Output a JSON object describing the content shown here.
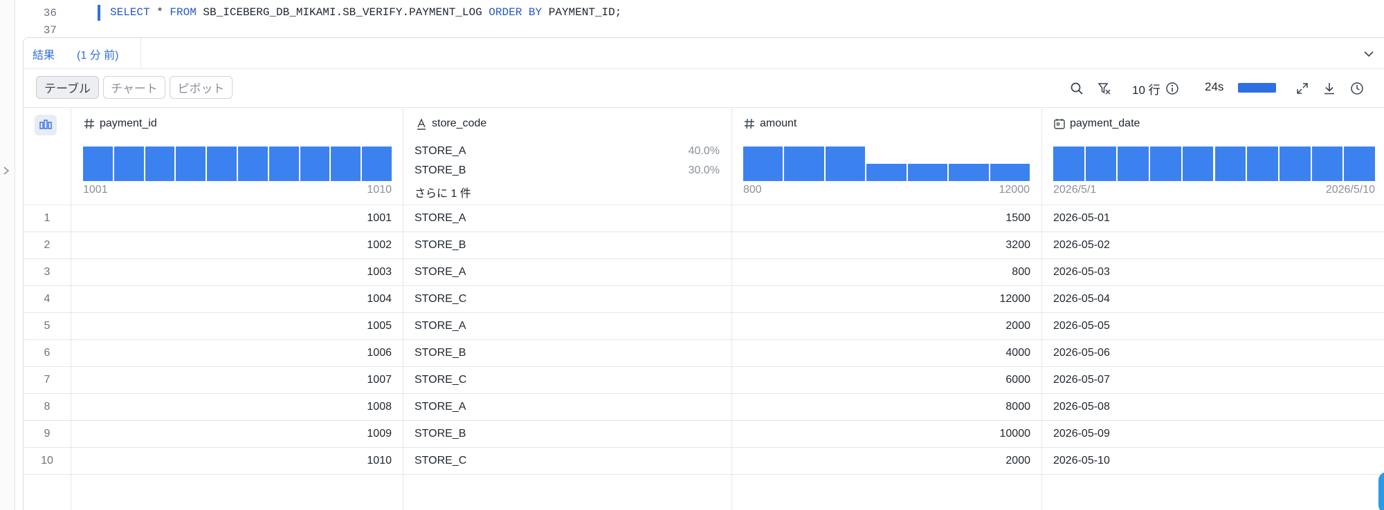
{
  "editor": {
    "lines": [
      {
        "number": "36",
        "tokens": [
          {
            "text": "SELECT",
            "kw": true
          },
          {
            "text": " * ",
            "kw": false
          },
          {
            "text": "FROM",
            "kw": true
          },
          {
            "text": " SB_ICEBERG_DB_MIKAMI.SB_VERIFY.PAYMENT_LOG ",
            "kw": false
          },
          {
            "text": "ORDER BY",
            "kw": true
          },
          {
            "text": " PAYMENT_ID;",
            "kw": false
          }
        ]
      },
      {
        "number": "37",
        "tokens": []
      }
    ]
  },
  "results": {
    "tab_label": "結果",
    "tab_time": "(1 分 前)",
    "view_buttons": [
      "テーブル",
      "チャート",
      "ピボット"
    ],
    "active_view": "テーブル",
    "row_count": "10 行",
    "elapsed": "24s",
    "progress": 1.0
  },
  "columns": [
    {
      "name": "payment_id",
      "type_icon": "hash-icon",
      "kind": "histogram",
      "bars": [
        1,
        1,
        1,
        1,
        1,
        1,
        1,
        1,
        1,
        1
      ],
      "min_label": "1001",
      "max_label": "1010"
    },
    {
      "name": "store_code",
      "type_icon": "text-type-icon",
      "kind": "categories",
      "categories": [
        {
          "label": "STORE_A",
          "pct": "40.0%"
        },
        {
          "label": "STORE_B",
          "pct": "30.0%"
        }
      ],
      "more_label": "さらに 1 件"
    },
    {
      "name": "amount",
      "type_icon": "hash-icon",
      "kind": "histogram",
      "bars": [
        1,
        1,
        1,
        0.5,
        0.5,
        0.5,
        0.5
      ],
      "min_label": "800",
      "max_label": "12000"
    },
    {
      "name": "payment_date",
      "type_icon": "calendar-icon",
      "kind": "histogram",
      "bars": [
        1,
        1,
        1,
        1,
        1,
        1,
        1,
        1,
        1,
        1
      ],
      "min_label": "2026/5/1",
      "max_label": "2026/5/10"
    }
  ],
  "rows": [
    {
      "n": "1",
      "payment_id": "1001",
      "store_code": "STORE_A",
      "amount": "1500",
      "payment_date": "2026-05-01"
    },
    {
      "n": "2",
      "payment_id": "1002",
      "store_code": "STORE_B",
      "amount": "3200",
      "payment_date": "2026-05-02"
    },
    {
      "n": "3",
      "payment_id": "1003",
      "store_code": "STORE_A",
      "amount": "800",
      "payment_date": "2026-05-03"
    },
    {
      "n": "4",
      "payment_id": "1004",
      "store_code": "STORE_C",
      "amount": "12000",
      "payment_date": "2026-05-04"
    },
    {
      "n": "5",
      "payment_id": "1005",
      "store_code": "STORE_A",
      "amount": "2000",
      "payment_date": "2026-05-05"
    },
    {
      "n": "6",
      "payment_id": "1006",
      "store_code": "STORE_B",
      "amount": "4000",
      "payment_date": "2026-05-06"
    },
    {
      "n": "7",
      "payment_id": "1007",
      "store_code": "STORE_C",
      "amount": "6000",
      "payment_date": "2026-05-07"
    },
    {
      "n": "8",
      "payment_id": "1008",
      "store_code": "STORE_A",
      "amount": "8000",
      "payment_date": "2026-05-08"
    },
    {
      "n": "9",
      "payment_id": "1009",
      "store_code": "STORE_B",
      "amount": "10000",
      "payment_date": "2026-05-09"
    },
    {
      "n": "10",
      "payment_id": "1010",
      "store_code": "STORE_C",
      "amount": "2000",
      "payment_date": "2026-05-10"
    }
  ],
  "colors": {
    "accent": "#2f6fe4",
    "bar": "#3b82f0",
    "fab": "#2a9be6"
  }
}
